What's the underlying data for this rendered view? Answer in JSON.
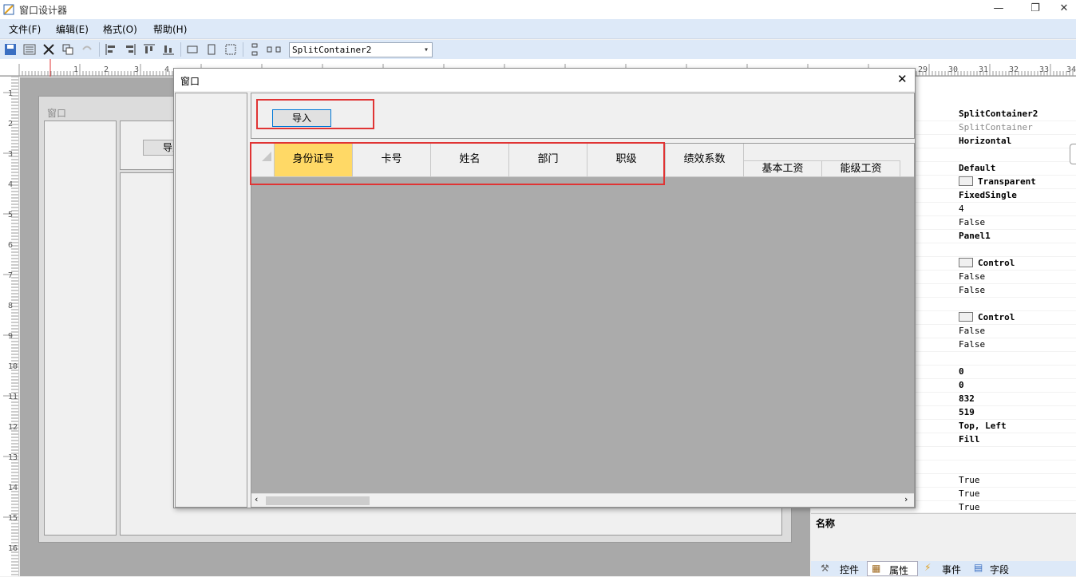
{
  "app": {
    "title": "窗口设计器"
  },
  "window_controls": {
    "minimize": "—",
    "restore": "❐",
    "close": "✕"
  },
  "menu": [
    "文件(F)",
    "编辑(E)",
    "格式(O)",
    "帮助(H)"
  ],
  "toolbar": {
    "combo_value": "SplitContainer2"
  },
  "ruler": {
    "h_left": [
      "1",
      "2",
      "3",
      "4"
    ],
    "h_right": [
      "29",
      "30",
      "31",
      "32",
      "33",
      "34"
    ],
    "v": [
      "1",
      "2",
      "3",
      "4",
      "5",
      "6",
      "7",
      "8",
      "9",
      "10",
      "11",
      "12",
      "13",
      "14",
      "15",
      "16"
    ]
  },
  "bg_form": {
    "title": "窗口",
    "button_label": "导入"
  },
  "dialog": {
    "title": "窗口",
    "close": "✕",
    "import_button": "导入",
    "columns": [
      "身份证号",
      "卡号",
      "姓名",
      "部门",
      "职级",
      "绩效系数"
    ],
    "sub_columns": [
      "基本工资",
      "能级工资"
    ]
  },
  "properties": [
    {
      "value": "SplitContainer2",
      "style": "b"
    },
    {
      "value": "SplitContainer",
      "style": "g"
    },
    {
      "value": "Horizontal",
      "style": "b"
    },
    {
      "value": "",
      "style": ""
    },
    {
      "value": "Default",
      "style": "b"
    },
    {
      "value": "Transparent",
      "style": "b",
      "swatch": true
    },
    {
      "value": "FixedSingle",
      "style": "b"
    },
    {
      "value": "4",
      "style": ""
    },
    {
      "value": "False",
      "style": ""
    },
    {
      "value": "Panel1",
      "style": "b"
    },
    {
      "value": "",
      "style": ""
    },
    {
      "value": "Control",
      "style": "b",
      "swatch": true
    },
    {
      "value": "False",
      "style": ""
    },
    {
      "value": "False",
      "style": ""
    },
    {
      "value": "",
      "style": ""
    },
    {
      "value": "Control",
      "style": "b",
      "swatch": true
    },
    {
      "value": "False",
      "style": ""
    },
    {
      "value": "False",
      "style": ""
    },
    {
      "value": "",
      "style": ""
    },
    {
      "value": "0",
      "style": "b"
    },
    {
      "value": "0",
      "style": "b"
    },
    {
      "value": "832",
      "style": "b"
    },
    {
      "value": "519",
      "style": "b"
    },
    {
      "value": "Top, Left",
      "style": "b"
    },
    {
      "value": "Fill",
      "style": "b"
    },
    {
      "value": "",
      "style": ""
    },
    {
      "value": "",
      "style": ""
    },
    {
      "value": "True",
      "style": ""
    },
    {
      "value": "True",
      "style": ""
    },
    {
      "value": "True",
      "style": ""
    }
  ],
  "description": {
    "label": "名称"
  },
  "bottom_tabs": [
    "控件",
    "属性",
    "事件",
    "字段"
  ]
}
